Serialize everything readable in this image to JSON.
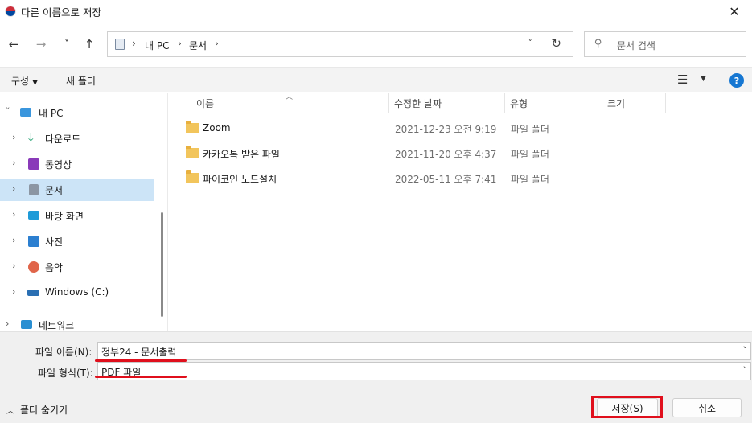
{
  "window": {
    "title": "다른 이름으로 저장",
    "close_glyph": "✕"
  },
  "nav": {
    "back_glyph": "←",
    "forward_glyph": "→",
    "recent_glyph": "˅",
    "up_glyph": "↑",
    "breadcrumb": [
      "내 PC",
      "문서"
    ],
    "dropdown_glyph": "˅",
    "refresh_glyph": "↻",
    "search_placeholder": "문서 검색"
  },
  "commandbar": {
    "organize_label": "구성",
    "new_folder_label": "새 폴더",
    "help_label": "?"
  },
  "sidebar": {
    "items": [
      {
        "label": "내 PC",
        "icon": "pc-icon",
        "color": "#3a96dd",
        "expanded": true
      },
      {
        "label": "다운로드",
        "icon": "download-icon",
        "color": "#1a9d6b"
      },
      {
        "label": "동영상",
        "icon": "video-icon",
        "color": "#8a3ab9"
      },
      {
        "label": "문서",
        "icon": "document-icon",
        "color": "#8c96a3",
        "selected": true
      },
      {
        "label": "바탕 화면",
        "icon": "desktop-icon",
        "color": "#1f9bd8"
      },
      {
        "label": "사진",
        "icon": "pictures-icon",
        "color": "#2c7fd0"
      },
      {
        "label": "음악",
        "icon": "music-icon",
        "color": "#e0654a"
      },
      {
        "label": "Windows (C:)",
        "icon": "drive-icon",
        "color": "#2a6fb3"
      },
      {
        "label": "네트워크",
        "icon": "network-icon",
        "color": "#2a8fd2"
      }
    ]
  },
  "filelist": {
    "columns": [
      "이름",
      "수정한 날짜",
      "유형",
      "크기"
    ],
    "rows": [
      {
        "name": "Zoom",
        "date": "2021-12-23 오전 9:19",
        "type": "파일 폴더"
      },
      {
        "name": "카카오톡 받은 파일",
        "date": "2021-11-20 오후 4:37",
        "type": "파일 폴더"
      },
      {
        "name": "파이코인 노드설치",
        "date": "2022-05-11 오후 7:41",
        "type": "파일 폴더"
      }
    ]
  },
  "form": {
    "filename_label": "파일 이름(N):",
    "filename_value": "정부24 - 문서출력",
    "filetype_label": "파일 형식(T):",
    "filetype_value": "PDF 파일"
  },
  "footer": {
    "hide_folders_label": "폴더 숨기기",
    "save_label": "저장(S)",
    "cancel_label": "취소"
  },
  "colors": {
    "highlight": "#e00f1c",
    "selected_bg": "#cce4f7",
    "accent": "#1677d2"
  }
}
